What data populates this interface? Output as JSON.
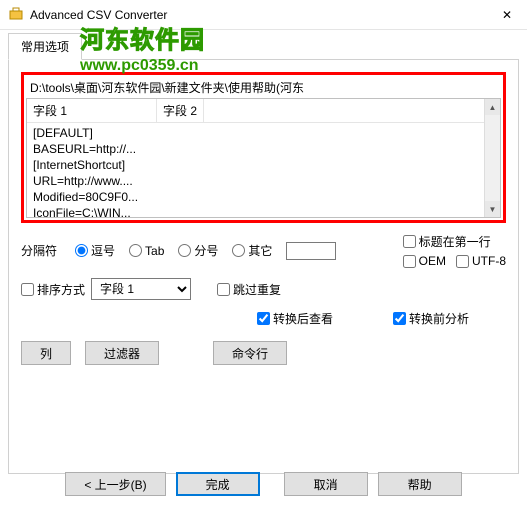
{
  "window": {
    "title": "Advanced CSV Converter",
    "close_icon": "✕"
  },
  "watermark": {
    "line1": "河东软件园",
    "line2": "www.pc0359.cn"
  },
  "tab": {
    "label": "常用选项"
  },
  "path": "D:\\tools\\桌面\\河东软件园\\新建文件夹\\使用帮助(河东",
  "preview": {
    "col1": "字段 1",
    "col2": "字段 2",
    "rows": [
      "[DEFAULT]",
      "BASEURL=http://...",
      "[InternetShortcut]",
      "URL=http://www....",
      "Modified=80C9F0...",
      "IconFile=C:\\WIN..."
    ]
  },
  "separator": {
    "label": "分隔符",
    "opt_comma": "逗号",
    "opt_tab": "Tab",
    "opt_semi": "分号",
    "opt_other": "其它"
  },
  "checks": {
    "header_first": "标题在第一行",
    "oem": "OEM",
    "utf8": "UTF-8",
    "sort": "排序方式",
    "skip_dup": "跳过重复",
    "view_after": "转换后查看",
    "analyze_before": "转换前分析"
  },
  "combo": {
    "field": "字段 1"
  },
  "buttons": {
    "columns": "列",
    "filter": "过滤器",
    "cmdline": "命令行",
    "back": "< 上一步(B)",
    "finish": "完成",
    "cancel": "取消",
    "help": "帮助"
  }
}
